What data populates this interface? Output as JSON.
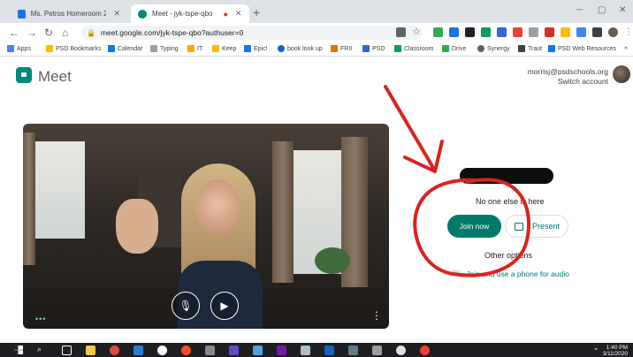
{
  "browser": {
    "tabs": [
      {
        "label": "Ms. Petros Homeroom 2019-202",
        "active": false
      },
      {
        "label": "Meet - jyk-tspe-qbo",
        "active": true
      }
    ],
    "new_tab_symbol": "+",
    "url": "meet.google.com/jyk-tspe-qbo?authuser=0",
    "bookmarks": [
      "Apps",
      "PSD Bookmarks",
      "Calendar",
      "Typing",
      "IT",
      "Keep",
      "Epic!",
      "book look up",
      "FRII",
      "PSD",
      "Classroom",
      "Drive",
      "Synergy",
      "Traut",
      "PSD Web Resources",
      "»"
    ]
  },
  "meet": {
    "brand": "Meet",
    "account_email": "morrisj@psdschools.org",
    "switch_account": "Switch account",
    "status_text": "No one else is here",
    "join_label": "Join now",
    "present_label": "Present",
    "other_options": "Other options",
    "phone_option": "Join and use a phone for audio"
  },
  "taskbar": {
    "time": "1:40 PM",
    "date": "3/11/2020"
  },
  "colors": {
    "accent": "#00796b",
    "annotation": "#d9231f"
  }
}
